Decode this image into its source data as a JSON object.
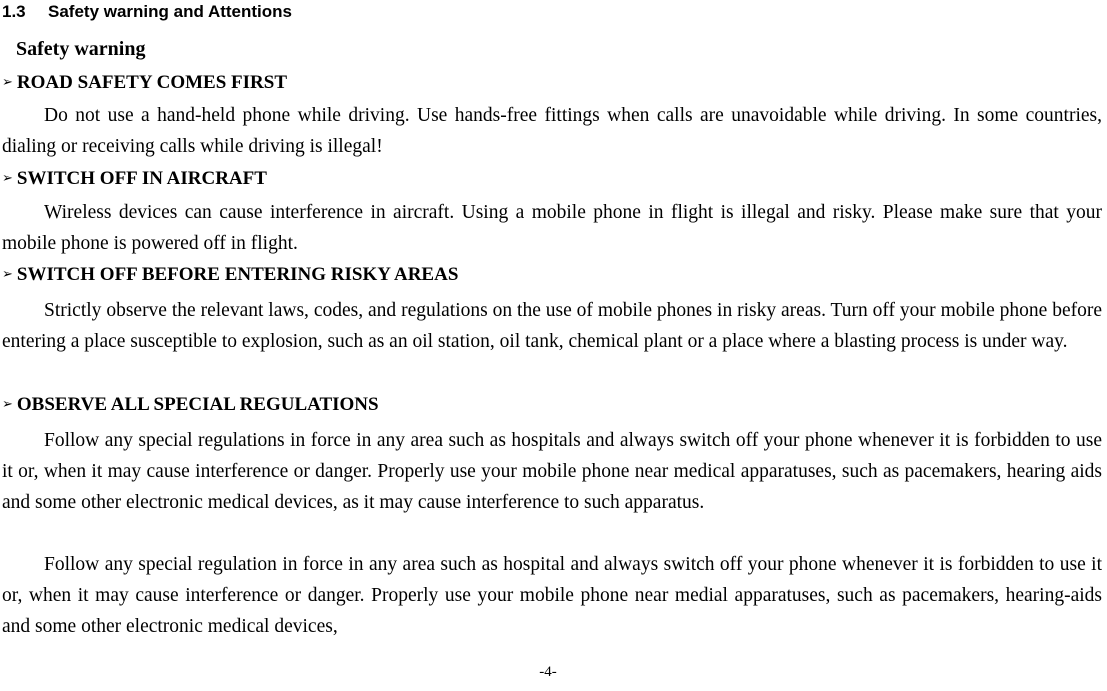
{
  "document": {
    "page_number_label": "-4-",
    "section": {
      "number": "1.3",
      "title": "Safety warning and Attentions"
    },
    "subheading": "Safety warning",
    "bullet_glyph": "➢",
    "blocks": [
      {
        "heading": "ROAD SAFETY COMES FIRST",
        "body": "Do not use a hand-held phone while driving. Use hands-free fittings when calls are unavoidable while driving. In some countries, dialing or receiving calls while driving is illegal!"
      },
      {
        "heading": "SWITCH OFF IN AIRCRAFT",
        "body": "Wireless devices can cause interference in aircraft. Using a mobile phone in flight is illegal and risky. Please make sure that your mobile phone is powered off in flight."
      },
      {
        "heading": "SWITCH OFF BEFORE ENTERING RISKY AREAS",
        "body": "Strictly observe the relevant laws, codes, and regulations on the use of mobile phones in risky areas. Turn off your mobile phone before entering a place susceptible to explosion, such as an oil station, oil tank, chemical plant or a place where a blasting process is under way."
      },
      {
        "heading": "OBSERVE ALL SPECIAL REGULATIONS",
        "body": "Follow any special regulations in force in any area such as hospitals and always switch off your phone whenever it is forbidden to use it or, when it may cause interference or danger. Properly use your mobile phone near medical apparatuses, such as pacemakers, hearing aids and some other electronic medical devices, as it may cause interference to such apparatus.",
        "body2": "Follow any special regulation in force in any area such as hospital and always switch off your phone whenever it is forbidden to use it or, when it may cause interference or danger. Properly use your mobile phone near medial apparatuses, such as pacemakers, hearing-aids and some other electronic medical devices,"
      }
    ]
  }
}
